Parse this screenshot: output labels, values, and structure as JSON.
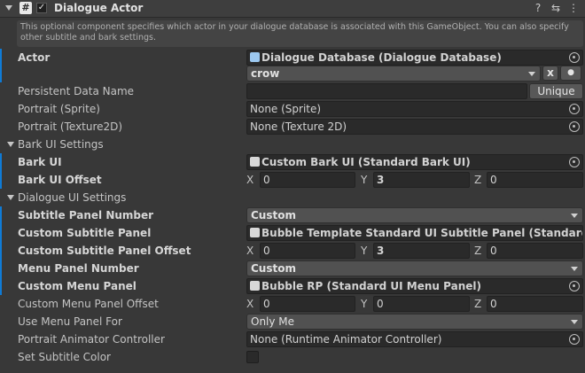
{
  "header": {
    "script_icon_glyph": "#",
    "enabled_glyph": "✓",
    "title": "Dialogue Actor",
    "help_glyph": "?",
    "presets_glyph": "⇆",
    "more_glyph": "⋮"
  },
  "help_text": "This optional component specifies which actor in your dialogue database is associated with this GameObject. You can also specify other subtitle and bark settings.",
  "actor": {
    "label": "Actor",
    "database_value": "Dialogue Database (Dialogue Database)",
    "actor_value": "crow",
    "clear_label": "x",
    "dot_label": "●"
  },
  "persistent": {
    "label": "Persistent Data Name",
    "value": "",
    "button": "Unique"
  },
  "portrait_sprite": {
    "label": "Portrait (Sprite)",
    "value": "None (Sprite)"
  },
  "portrait_texture": {
    "label": "Portrait (Texture2D)",
    "value": "None (Texture 2D)"
  },
  "bark_group": {
    "label": "Bark UI Settings"
  },
  "bark_ui": {
    "label": "Bark UI",
    "value": "Custom Bark UI (Standard Bark UI)"
  },
  "bark_offset": {
    "label": "Bark UI Offset",
    "x": "0",
    "y": "3",
    "z": "0"
  },
  "dialogue_group": {
    "label": "Dialogue UI Settings"
  },
  "subtitle_panel_number": {
    "label": "Subtitle Panel Number",
    "value": "Custom"
  },
  "custom_subtitle_panel": {
    "label": "Custom Subtitle Panel",
    "value": "Bubble Template Standard UI Subtitle Panel (Standard UI S"
  },
  "custom_subtitle_offset": {
    "label": "Custom Subtitle Panel Offset",
    "x": "0",
    "y": "3",
    "z": "0"
  },
  "menu_panel_number": {
    "label": "Menu Panel Number",
    "value": "Custom"
  },
  "custom_menu_panel": {
    "label": "Custom Menu Panel",
    "value": "Bubble RP (Standard UI Menu Panel)"
  },
  "custom_menu_offset": {
    "label": "Custom Menu Panel Offset",
    "x": "0",
    "y": "0",
    "z": "0"
  },
  "use_menu_panel_for": {
    "label": "Use Menu Panel For",
    "value": "Only Me"
  },
  "portrait_animator": {
    "label": "Portrait Animator Controller",
    "value": "None (Runtime Animator Controller)"
  },
  "set_subtitle_color": {
    "label": "Set Subtitle Color",
    "checked": false
  },
  "axes": {
    "x": "X",
    "y": "Y",
    "z": "Z"
  },
  "colors": {
    "accent": "#0f7bd6",
    "background": "#383838"
  }
}
